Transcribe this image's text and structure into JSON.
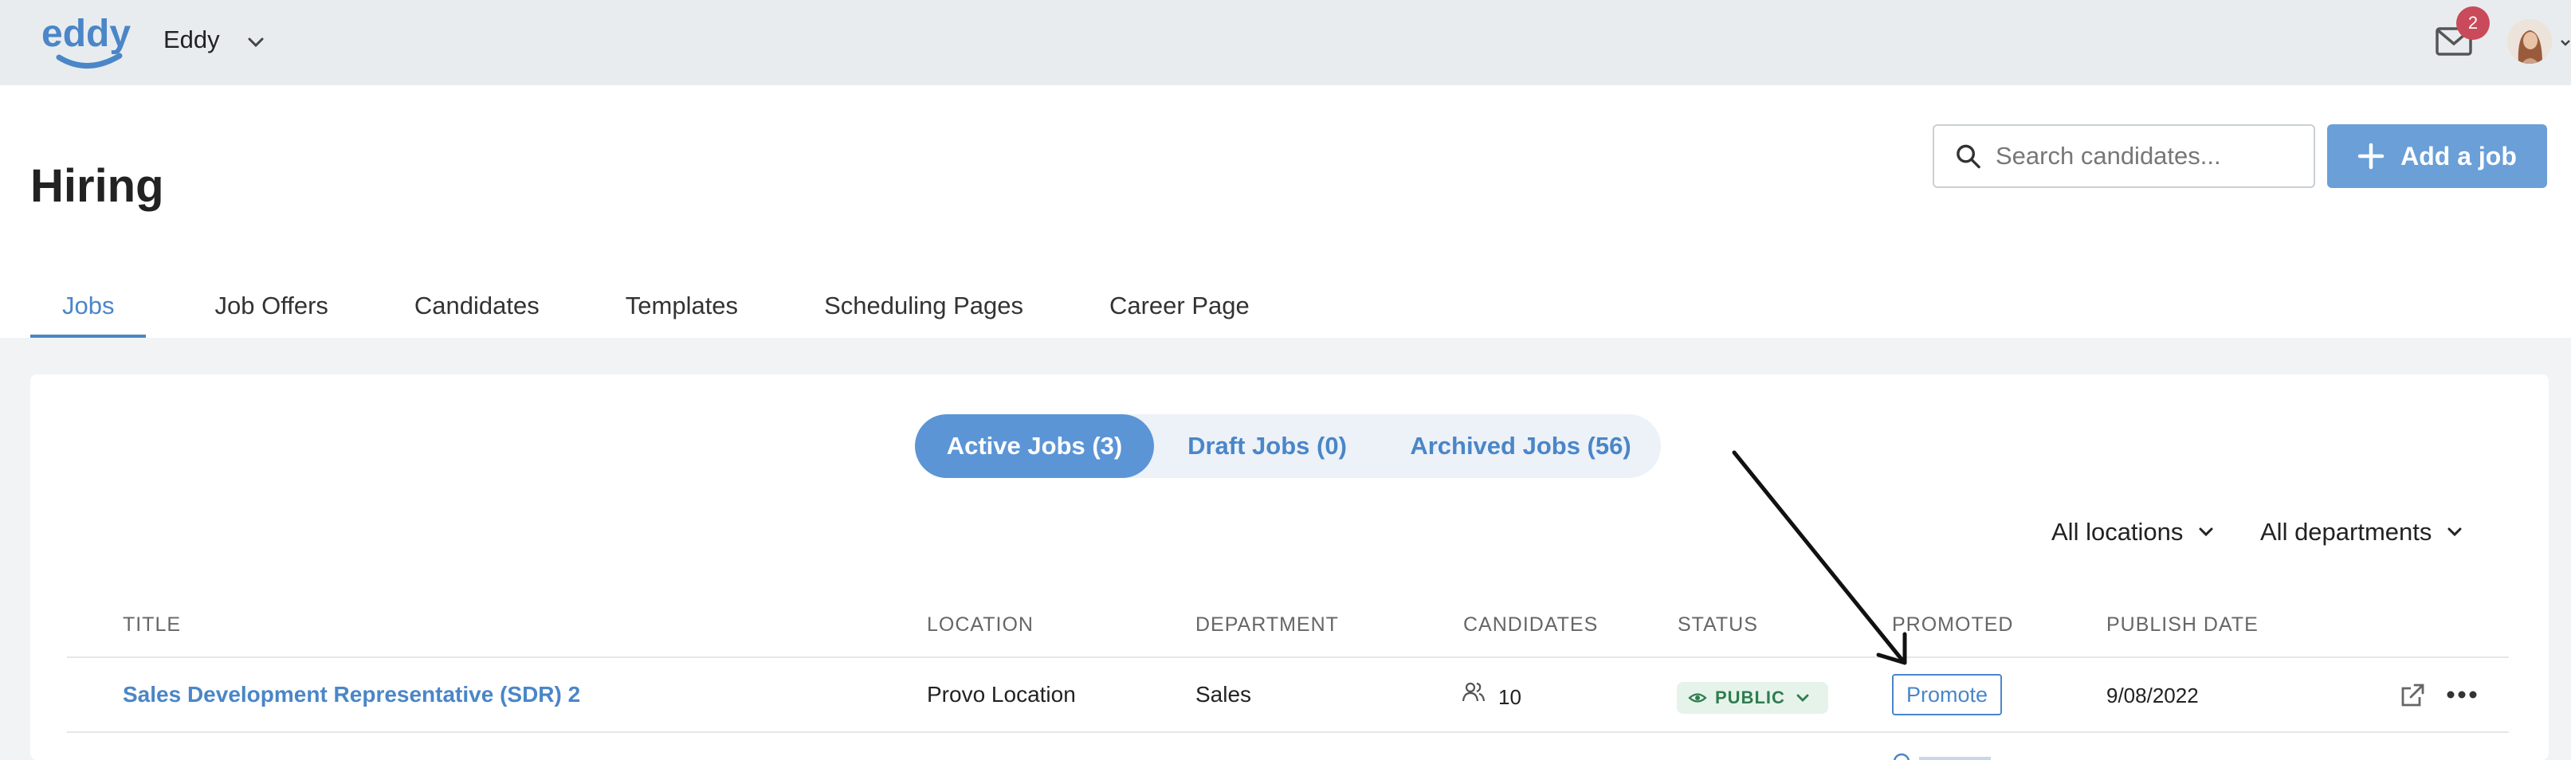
{
  "topbar": {
    "logo_text": "eddy",
    "org_name": "Eddy",
    "notifications_count": "2"
  },
  "header": {
    "title": "Hiring",
    "search_placeholder": "Search candidates...",
    "add_job_label": "Add a job"
  },
  "tabs": [
    {
      "label": "Jobs",
      "active": true
    },
    {
      "label": "Job Offers"
    },
    {
      "label": "Candidates"
    },
    {
      "label": "Templates"
    },
    {
      "label": "Scheduling Pages"
    },
    {
      "label": "Career Page"
    }
  ],
  "segments": [
    {
      "label": "Active Jobs (3)",
      "active": true
    },
    {
      "label": "Draft Jobs (0)"
    },
    {
      "label": "Archived Jobs (56)"
    }
  ],
  "filters": {
    "location": "All locations",
    "department": "All departments"
  },
  "table": {
    "columns": [
      "TITLE",
      "LOCATION",
      "DEPARTMENT",
      "CANDIDATES",
      "STATUS",
      "PROMOTED",
      "PUBLISH DATE"
    ],
    "rows": [
      {
        "title": "Sales Development Representative (SDR) 2",
        "location": "Provo Location",
        "department": "Sales",
        "candidates": "10",
        "status": "PUBLIC",
        "promoted_action": "Promote",
        "publish_date": "9/08/2022"
      }
    ]
  },
  "colors": {
    "accent": "#4a86c8",
    "primary_button": "#6a9fd8",
    "topbar_bg": "#e8ecef",
    "status_green": "#2e7d4f",
    "badge_red": "#c94a5a"
  }
}
